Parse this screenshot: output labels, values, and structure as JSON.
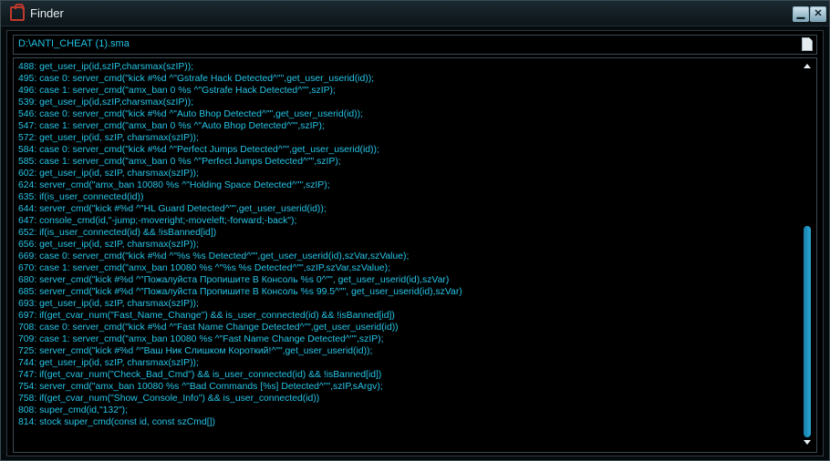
{
  "window": {
    "title": "Finder",
    "minimize_label": "▁",
    "close_label": "✕"
  },
  "path": "D:\\ANTI_CHEAT (1).sma",
  "lines": [
    "488: get_user_ip(id,szIP,charsmax(szIP));",
    "495: case 0: server_cmd(\"kick #%d ^\"Gstrafe Hack Detected^\"\",get_user_userid(id));",
    "496: case 1: server_cmd(\"amx_ban 0 %s ^\"Gstrafe Hack Detected^\"\",szIP);",
    "539: get_user_ip(id,szIP,charsmax(szIP));",
    "546: case 0: server_cmd(\"kick #%d ^\"Auto Bhop Detected^\"\",get_user_userid(id));",
    "547: case 1: server_cmd(\"amx_ban 0 %s ^\"Auto Bhop Detected^\"\",szIP);",
    "572: get_user_ip(id, szIP, charsmax(szIP));",
    "584: case 0: server_cmd(\"kick #%d ^\"Perfect Jumps Detected^\"\",get_user_userid(id));",
    "585: case 1: server_cmd(\"amx_ban 0 %s ^\"Perfect Jumps Detected^\"\",szIP);",
    "602: get_user_ip(id, szIP, charsmax(szIP));",
    "624: server_cmd(\"amx_ban 10080 %s ^\"Holding Space Detected^\"\",szIP);",
    "635: if(is_user_connected(id))",
    "644: server_cmd(\"kick #%d ^\"HL Guard Detected^\"\",get_user_userid(id));",
    "647: console_cmd(id,\"-jump;-moveright;-moveleft;-forward;-back\");",
    "652: if(is_user_connected(id) && !isBanned[id])",
    "656: get_user_ip(id, szIP, charsmax(szIP));",
    "669: case 0: server_cmd(\"kick #%d ^\"%s %s Detected^\"\",get_user_userid(id),szVar,szValue);",
    "670: case 1: server_cmd(\"amx_ban 10080 %s ^\"%s %s Detected^\"\",szIP,szVar,szValue);",
    "680: server_cmd(\"kick #%d ^\"Пожалуйста Пропишите В Консоль %s 0^\"\", get_user_userid(id),szVar)",
    "685: server_cmd(\"kick #%d ^\"Пожалуйста Пропишите В Консоль %s 99.5^\"\", get_user_userid(id),szVar)",
    "693: get_user_ip(id, szIP, charsmax(szIP));",
    "697: if(get_cvar_num(\"Fast_Name_Change\") && is_user_connected(id) && !isBanned[id])",
    "708: case 0: server_cmd(\"kick #%d ^\"Fast Name Change Detected^\"\",get_user_userid(id))",
    "709: case 1: server_cmd(\"amx_ban 10080 %s ^\"Fast Name Change Detected^\"\",szIP);",
    "725: server_cmd(\"kick #%d ^\"Ваш Ник Слишком Короткий!^\"\",get_user_userid(id));",
    "744: get_user_ip(id, szIP, charsmax(szIP));",
    "747: if(get_cvar_num(\"Check_Bad_Cmd\") && is_user_connected(id) && !isBanned[id])",
    "754: server_cmd(\"amx_ban 10080 %s ^\"Bad Commands [%s] Detected^\"\",szIP,sArgv);",
    "758: if(get_cvar_num(\"Show_Console_Info\") && is_user_connected(id))",
    "808: super_cmd(id,\"132\");",
    "814: stock super_cmd(const id, const szCmd[])"
  ],
  "scrollbar": {
    "position_fraction": 0.46
  }
}
